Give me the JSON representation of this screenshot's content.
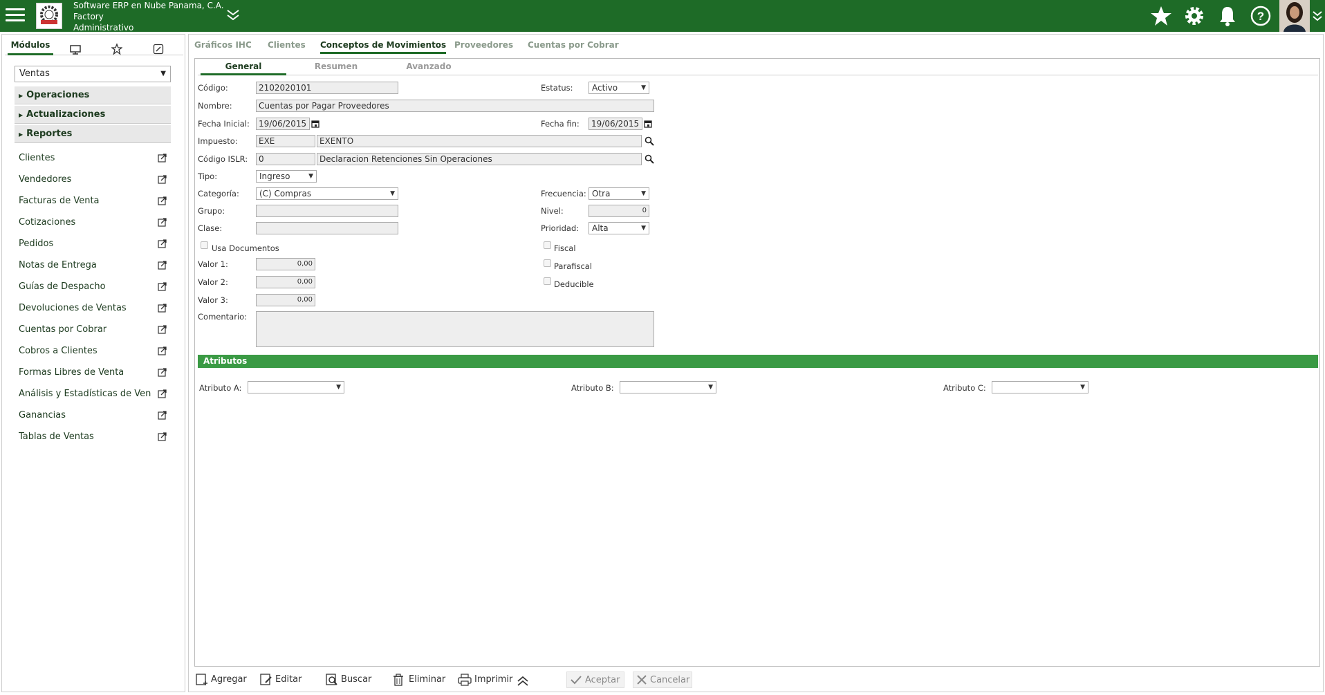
{
  "header": {
    "company_line1": "Software ERP en Nube Panama, C.A.",
    "company_line2": "Factory",
    "company_line3": "Administrativo"
  },
  "sidebar": {
    "tabs": [
      "Módulos"
    ],
    "module_select": "Ventas",
    "accordions": [
      "Operaciones",
      "Actualizaciones",
      "Reportes"
    ],
    "items": [
      "Clientes",
      "Vendedores",
      "Facturas de Venta",
      "Cotizaciones",
      "Pedidos",
      "Notas de Entrega",
      "Guías de Despacho",
      "Devoluciones de Ventas",
      "Cuentas por Cobrar",
      "Cobros a Clientes",
      "Formas Libres de Venta",
      "Análisis y Estadísticas de Ven",
      "Ganancias",
      "Tablas de Ventas"
    ]
  },
  "main": {
    "tabs": [
      "Gráficos IHC",
      "Clientes",
      "Conceptos de Movimientos",
      "Proveedores",
      "Cuentas por Cobrar"
    ],
    "subtabs": [
      "General",
      "Resumen",
      "Avanzado"
    ],
    "form": {
      "codigo_label": "Código:",
      "codigo_value": "2102020101",
      "estatus_label": "Estatus:",
      "estatus_value": "Activo",
      "nombre_label": "Nombre:",
      "nombre_value": "Cuentas por Pagar Proveedores",
      "fecha_inicial_label": "Fecha Inicial:",
      "fecha_inicial_value": "19/06/2015",
      "fecha_fin_label": "Fecha fin:",
      "fecha_fin_value": "19/06/2015",
      "impuesto_label": "Impuesto:",
      "impuesto_code": "EXE",
      "impuesto_desc": "EXENTO",
      "islr_label": "Código ISLR:",
      "islr_code": "0",
      "islr_desc": "Declaracion Retenciones Sin Operaciones",
      "tipo_label": "Tipo:",
      "tipo_value": "Ingreso",
      "categoria_label": "Categoría:",
      "categoria_value": "(C) Compras",
      "frecuencia_label": "Frecuencia:",
      "frecuencia_value": "Otra",
      "grupo_label": "Grupo:",
      "nivel_label": "Nivel:",
      "nivel_value": "0",
      "clase_label": "Clase:",
      "prioridad_label": "Prioridad:",
      "prioridad_value": "Alta",
      "usa_documentos_label": "Usa Documentos",
      "fiscal_label": "Fiscal",
      "parafiscal_label": "Parafiscal",
      "deducible_label": "Deducible",
      "valor1_label": "Valor 1:",
      "valor1_value": "0,00",
      "valor2_label": "Valor 2:",
      "valor2_value": "0,00",
      "valor3_label": "Valor 3:",
      "valor3_value": "0,00",
      "comentario_label": "Comentario:"
    },
    "atributos": {
      "title": "Atributos",
      "a_label": "Atributo A:",
      "b_label": "Atributo B:",
      "c_label": "Atributo C:"
    }
  },
  "toolbar": {
    "agregar": "Agregar",
    "editar": "Editar",
    "buscar": "Buscar",
    "eliminar": "Eliminar",
    "imprimir": "Imprimir",
    "aceptar": "Aceptar",
    "cancelar": "Cancelar"
  },
  "colors": {
    "header_bg": "#1e6b27",
    "section_bar": "#3a9a44",
    "active_tab_text": "#1d3b1f"
  }
}
